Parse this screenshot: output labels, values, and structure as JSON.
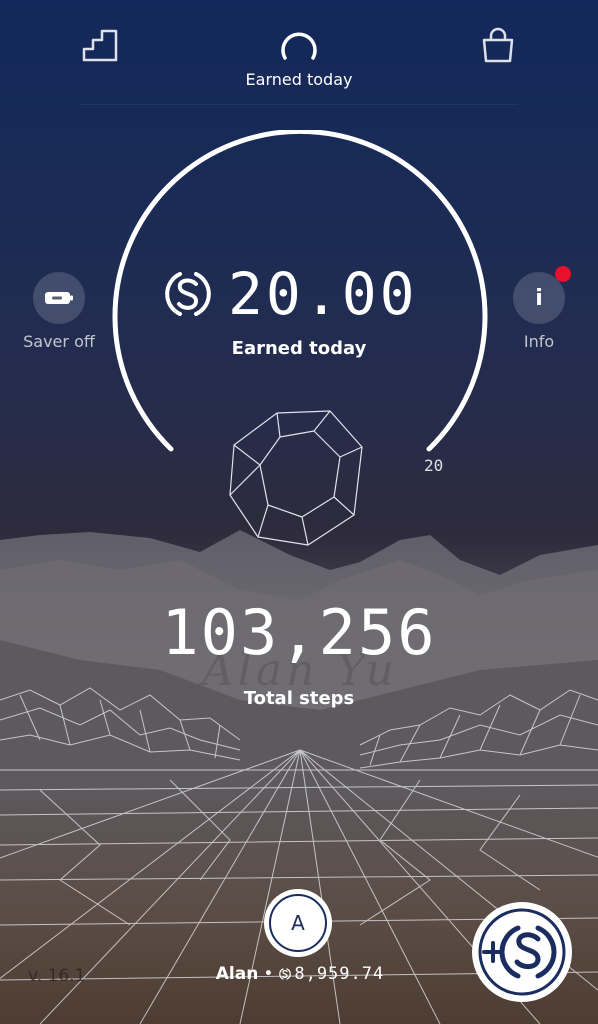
{
  "topbar": {
    "left_icon": "stairs-icon",
    "center_icon": "arc-meter-icon",
    "center_label": "Earned today",
    "right_icon": "shopping-bag-icon"
  },
  "side": {
    "saver_label": "Saver off",
    "saver_icon": "battery-icon",
    "info_label": "Info",
    "info_glyph": "i",
    "info_badge_color": "#e8102a"
  },
  "earned": {
    "currency_icon": "sweatcoin-icon",
    "amount": "20.00",
    "label": "Earned today",
    "limit_label": "20"
  },
  "steps": {
    "value": "103,256",
    "label": "Total steps"
  },
  "watermark": "Alan Yu",
  "footer": {
    "version": "v. 16.1",
    "avatar_letter": "A",
    "user_name": "Alan",
    "separator": "•",
    "balance_icon": "sweatcoin-icon",
    "balance": "8,959.74",
    "add_button_icon": "plus-sweatcoin-icon"
  },
  "colors": {
    "accent_navy": "#1b2d5e",
    "badge_red": "#e8102a"
  }
}
